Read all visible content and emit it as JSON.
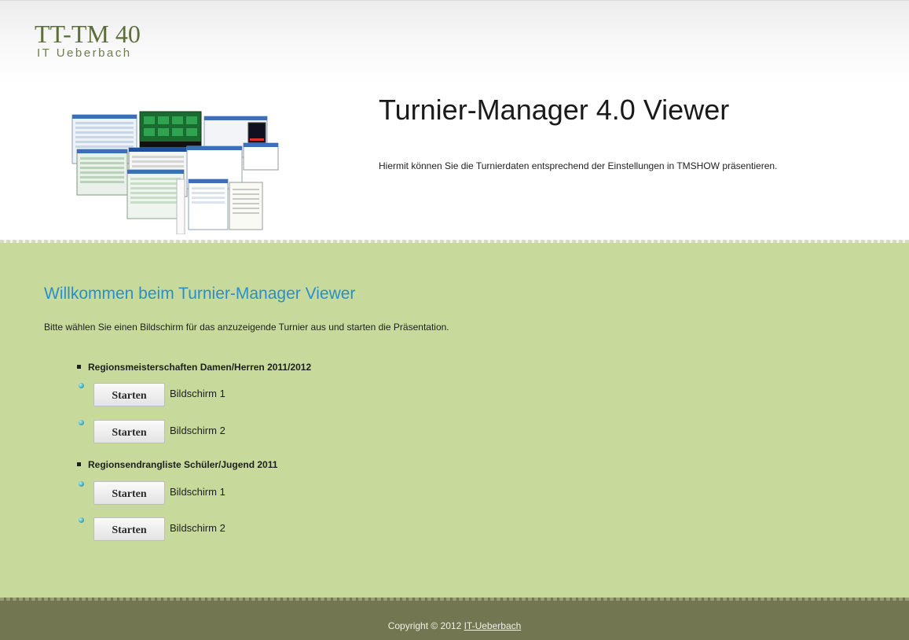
{
  "header": {
    "logo_title": "TT-TM 40",
    "logo_subtitle": "IT Ueberbach",
    "title": "Turnier-Manager 4.0 Viewer",
    "description": "Hiermit können Sie die Turnierdaten entsprechend der Einstellungen in TMSHOW präsentieren."
  },
  "main": {
    "welcome": "Willkommen beim Turnier-Manager Viewer",
    "intro": "Bitte wählen Sie einen Bildschirm für das anzuzeigende Turnier aus und starten die Präsentation.",
    "tournaments": [
      {
        "name": "Regionsmeisterschaften Damen/Herren 2011/2012",
        "screens": [
          {
            "button": "Starten",
            "label": "Bildschirm 1"
          },
          {
            "button": "Starten",
            "label": "Bildschirm 2"
          }
        ]
      },
      {
        "name": "Regionsendrangliste Schüler/Jugend 2011",
        "screens": [
          {
            "button": "Starten",
            "label": "Bildschirm 1"
          },
          {
            "button": "Starten",
            "label": "Bildschirm 2"
          }
        ]
      }
    ]
  },
  "footer": {
    "copyright": "Copyright © 2012 ",
    "link": "IT-Ueberbach"
  },
  "colors": {
    "content_bg": "#c7da9c",
    "footer_bg": "#727752",
    "heading_blue": "#2a8fc9",
    "logo_green": "#5c6f3a"
  }
}
